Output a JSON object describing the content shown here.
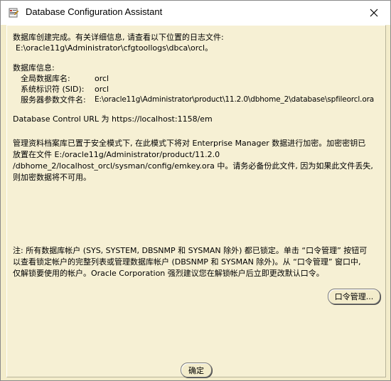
{
  "window": {
    "title": "Database Configuration Assistant",
    "icon": "dbca-app-icon",
    "close_icon": "close-icon"
  },
  "message": {
    "complete_line": "数据库创建完成。有关详细信息, 请查看以下位置的日志文件:",
    "log_path": "E:\\oracle11g\\Administrator\\cfgtoollogs\\dbca\\orcl。",
    "db_info_heading": "数据库信息:",
    "global_db_name_label": "全局数据库名:",
    "global_db_name_value": "orcl",
    "sid_label": "系统标识符 (SID):",
    "sid_value": "orcl",
    "param_file_label": "服务器参数文件名:",
    "param_file_value": "E:\\oracle11g\\Administrator\\product\\11.2.0\\dbhome_2\\database\\spfileorcl.ora",
    "control_url": "Database Control URL 为 https://localhost:1158/em",
    "secure_mode_lines": [
      "管理资料档案库已置于安全模式下, 在此模式下将对 Enterprise Manager 数据进行加密。加密密钥已",
      "放置在文件 E:/oracle11g/Administrator/product/11.2.0",
      "/dbhome_2/localhost_orcl/sysman/config/emkey.ora 中。请务必备份此文件, 因为如果此文件丢失,",
      "则加密数据将不可用。"
    ],
    "note_lines": [
      "注: 所有数据库帐户 (SYS, SYSTEM, DBSNMP 和 SYSMAN 除外) 都已锁定。单击 “口令管理” 按钮可",
      "以查看锁定帐户的完整列表或管理数据库帐户 (DBSNMP 和 SYSMAN 除外)。从 “口令管理” 窗口中,",
      "仅解锁要使用的帐户。Oracle Corporation 强烈建议您在解锁帐户后立即更改默认口令。"
    ]
  },
  "buttons": {
    "password_management": "口令管理...",
    "ok": "确定"
  }
}
